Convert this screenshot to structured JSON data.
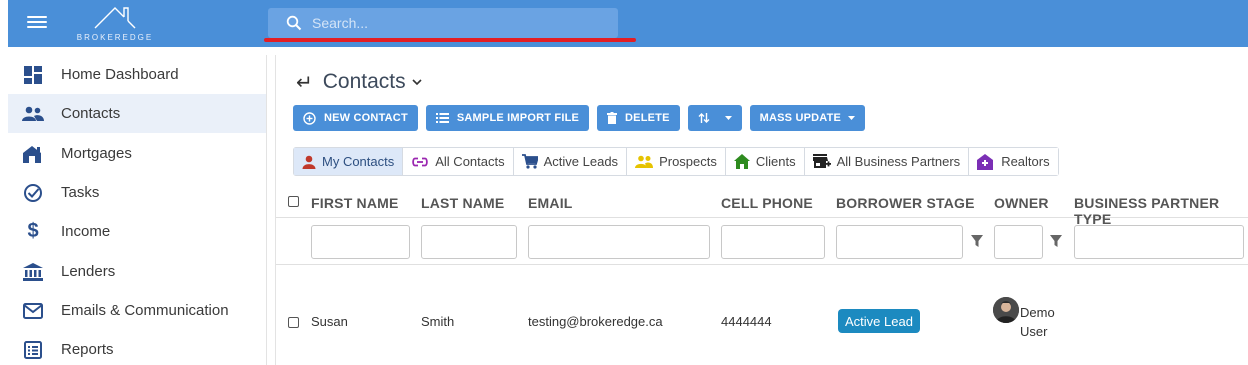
{
  "app": {
    "logo_text": "BROKEREDGE"
  },
  "search": {
    "placeholder": "Search..."
  },
  "sidebar": {
    "items": [
      {
        "label": "Home Dashboard",
        "icon": "dashboard-icon"
      },
      {
        "label": "Contacts",
        "icon": "people-icon",
        "active": true
      },
      {
        "label": "Mortgages",
        "icon": "house-icon"
      },
      {
        "label": "Tasks",
        "icon": "check-circle-icon"
      },
      {
        "label": "Income",
        "icon": "dollar-icon"
      },
      {
        "label": "Lenders",
        "icon": "bank-icon"
      },
      {
        "label": "Emails & Communication",
        "icon": "mail-icon"
      },
      {
        "label": "Reports",
        "icon": "list-icon"
      }
    ]
  },
  "page": {
    "title": "Contacts"
  },
  "toolbar": {
    "new_contact": "NEW CONTACT",
    "sample_import": "SAMPLE IMPORT FILE",
    "delete": "DELETE",
    "mass_update": "MASS UPDATE"
  },
  "filter_tabs": [
    {
      "label": "My Contacts",
      "icon": "person-icon",
      "color": "#c0392b",
      "active": true
    },
    {
      "label": "All Contacts",
      "icon": "link-icon",
      "color": "#9b27b0"
    },
    {
      "label": "Active Leads",
      "icon": "cart-icon",
      "color": "#2b4f8c"
    },
    {
      "label": "Prospects",
      "icon": "group-icon",
      "color": "#e6c300"
    },
    {
      "label": "Clients",
      "icon": "home-icon",
      "color": "#2e8b1f"
    },
    {
      "label": "All Business Partners",
      "icon": "store-icon",
      "color": "#222222"
    },
    {
      "label": "Realtors",
      "icon": "house-plus-icon",
      "color": "#7b2fb5"
    }
  ],
  "table": {
    "columns": [
      "FIRST NAME",
      "LAST NAME",
      "EMAIL",
      "CELL PHONE",
      "BORROWER STAGE",
      "OWNER",
      "BUSINESS PARTNER TYPE"
    ],
    "rows": [
      {
        "first_name": "Susan",
        "last_name": "Smith",
        "email": "testing@brokeredge.ca",
        "cell_phone": "4444444",
        "borrower_stage": "Active Lead",
        "owner": "Demo User"
      }
    ]
  },
  "colors": {
    "primary": "#4a8fd8",
    "badge": "#1c8ac0",
    "highlight": "#e31e24"
  }
}
